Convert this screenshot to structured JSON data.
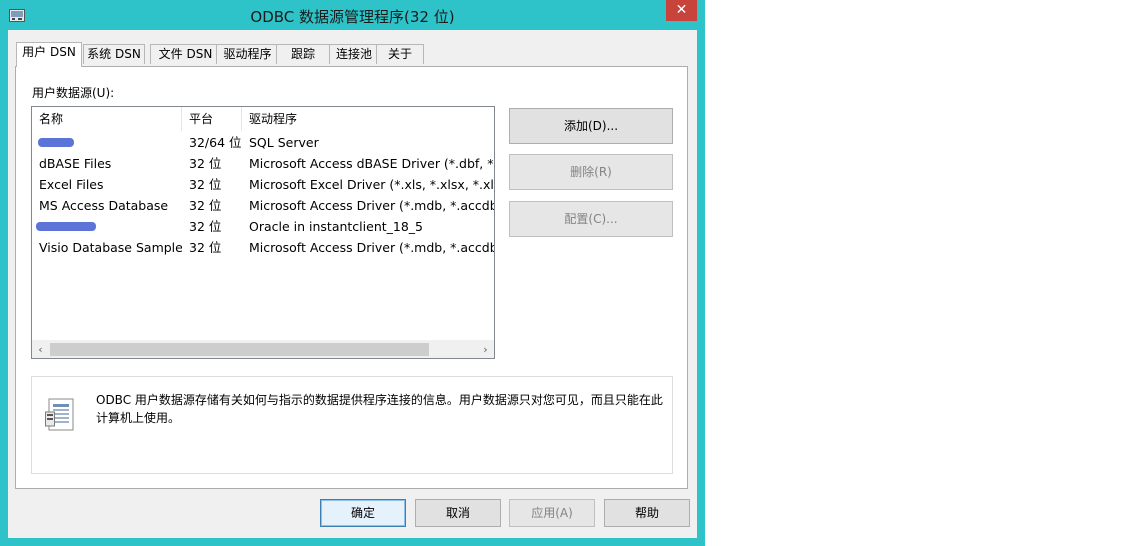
{
  "window": {
    "title": "ODBC 数据源管理程序(32 位)",
    "close_glyph": "✕",
    "accent_color": "#2ec3c8",
    "close_color": "#c7433b"
  },
  "tabs": [
    {
      "label": "用户 DSN",
      "active": true
    },
    {
      "label": "系统 DSN"
    },
    {
      "label": "文件 DSN"
    },
    {
      "label": "驱动程序"
    },
    {
      "label": "跟踪"
    },
    {
      "label": "连接池"
    },
    {
      "label": "关于"
    }
  ],
  "user_dsn": {
    "sources_label": "用户数据源(U):",
    "columns": [
      "名称",
      "平台",
      "驱动程序"
    ],
    "rows": [
      {
        "name": "",
        "platform": "32/64 位",
        "driver": "SQL Server",
        "redacted": true
      },
      {
        "name": "dBASE Files",
        "platform": "32 位",
        "driver": "Microsoft Access dBASE Driver (*.dbf, *.nd"
      },
      {
        "name": "Excel Files",
        "platform": "32 位",
        "driver": "Microsoft Excel Driver (*.xls, *.xlsx, *.xlsm, *"
      },
      {
        "name": "MS Access Database",
        "platform": "32 位",
        "driver": "Microsoft Access Driver (*.mdb, *.accdb)"
      },
      {
        "name": "",
        "platform": "32 位",
        "driver": "Oracle in instantclient_18_5",
        "redacted": true
      },
      {
        "name": "Visio Database Samples",
        "platform": "32 位",
        "driver": "Microsoft Access Driver (*.mdb, *.accdb)"
      }
    ],
    "scroll_left": "‹",
    "scroll_right": "›",
    "buttons": {
      "add": "添加(D)...",
      "remove": "删除(R)",
      "configure": "配置(C)..."
    },
    "info_text": "ODBC 用户数据源存储有关如何与指示的数据提供程序连接的信息。用户数据源只对您可见，而且只能在此计算机上使用。"
  },
  "footer": {
    "ok": "确定",
    "cancel": "取消",
    "apply": "应用(A)",
    "help": "帮助"
  }
}
